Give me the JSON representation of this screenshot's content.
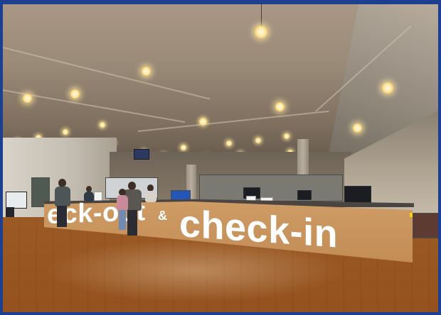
{
  "scene": {
    "counter_sign": {
      "left_text": "eck-out",
      "amp_text": "&",
      "right_text": "check-in"
    }
  },
  "colors": {
    "frame_border": "#1d3f8f",
    "counter": "#c8935c",
    "floor": "#c5955f",
    "ceiling": "#9a8a78"
  }
}
